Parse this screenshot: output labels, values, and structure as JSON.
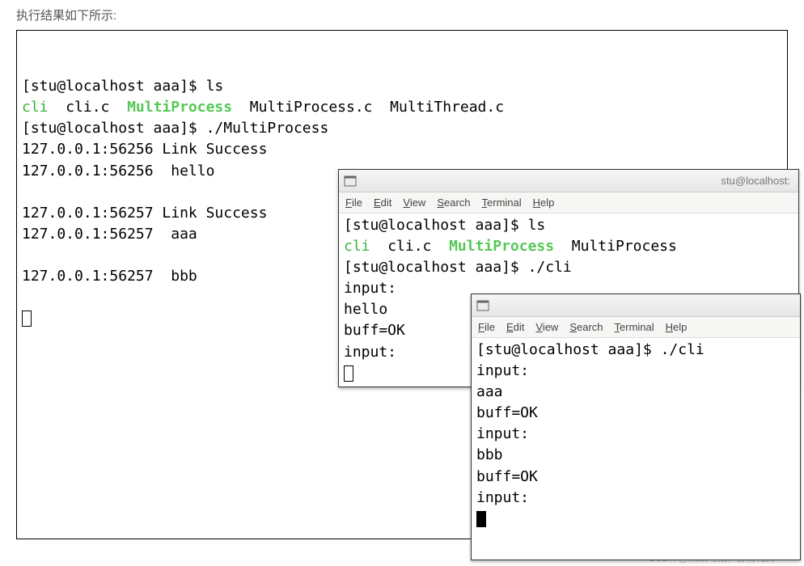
{
  "caption": "执行结果如下所示:",
  "watermark": "CSDN @未来可期，静待花开~",
  "menu": {
    "file": "File",
    "edit": "Edit",
    "view": "View",
    "search": "Search",
    "terminal": "Terminal",
    "help": "Help"
  },
  "window2_title": "stu@localhost:",
  "term1": {
    "line1_prompt": "[stu@localhost aaa]$ ",
    "line1_cmd": "ls",
    "ls_cli": "cli",
    "ls_clic": "  cli.c  ",
    "ls_multi": "MultiProcess",
    "ls_rest": "  MultiProcess.c  MultiThread.c",
    "line3_prompt": "[stu@localhost aaa]$ ",
    "line3_cmd": "./MultiProcess",
    "line4": "127.0.0.1:56256 Link Success",
    "line5": "127.0.0.1:56256  hello",
    "blank": "",
    "line7": "127.0.0.1:56257 Link Success",
    "line8": "127.0.0.1:56257  aaa",
    "line10": "127.0.0.1:56257  bbb"
  },
  "term2": {
    "line1_prompt": "[stu@localhost aaa]$ ",
    "line1_cmd": "ls",
    "ls_cli": "cli",
    "ls_clic": "  cli.c  ",
    "ls_multi": "MultiProcess",
    "ls_rest": "  MultiProcess",
    "line3_prompt": "[stu@localhost aaa]$ ",
    "line3_cmd": "./cli",
    "line4": "input:",
    "line5": "hello",
    "line6": "buff=OK",
    "line7": "input:"
  },
  "term3": {
    "line1_prompt": "[stu@localhost aaa]$ ",
    "line1_cmd": "./cli",
    "line2": "input:",
    "line3": "aaa",
    "line4": "buff=OK",
    "line5": "input:",
    "line6": "bbb",
    "line7": "buff=OK",
    "line8": "input:"
  }
}
